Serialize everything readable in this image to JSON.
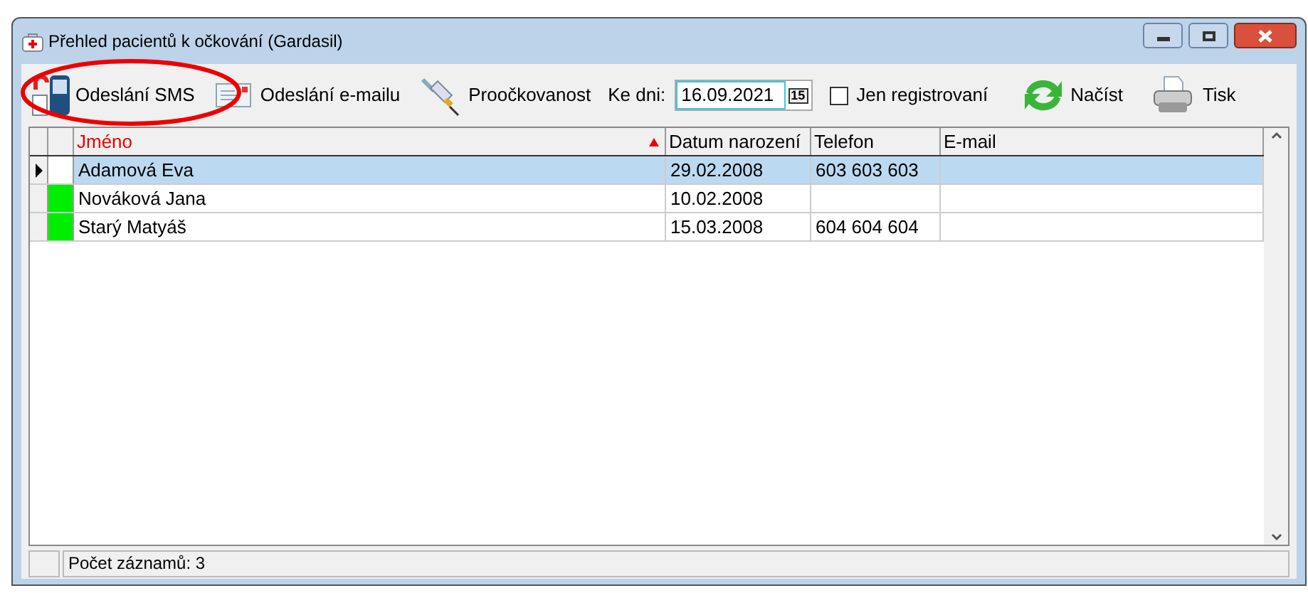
{
  "window": {
    "title": "Přehled pacientů k očkování (Gardasil)"
  },
  "toolbar": {
    "sms_button": {
      "label": "Odeslání SMS",
      "highlighted": true
    },
    "email_button": {
      "label": "Odeslání e-mailu"
    },
    "coverage_button": {
      "label": "Proočkovanost"
    },
    "date": {
      "label": "Ke dni:",
      "value": "16.09.2021",
      "calendar_glyph": "15"
    },
    "registered_only": {
      "label": "Jen registrovaní",
      "checked": false
    },
    "load_button": {
      "label": "Načíst"
    },
    "print_button": {
      "label": "Tisk"
    }
  },
  "table": {
    "columns": [
      {
        "label": "Jméno",
        "sorted": true
      },
      {
        "label": "Datum narození",
        "sorted": false
      },
      {
        "label": "Telefon",
        "sorted": false
      },
      {
        "label": "E-mail",
        "sorted": false
      }
    ],
    "rows": [
      {
        "selected": true,
        "color": "#ffffff",
        "cells": [
          "Adamová Eva",
          "29.02.2008",
          "603 603 603",
          ""
        ]
      },
      {
        "selected": false,
        "color": "#00ee00",
        "cells": [
          "Nováková Jana",
          "10.02.2008",
          "",
          ""
        ]
      },
      {
        "selected": false,
        "color": "#00ee00",
        "cells": [
          "Starý Matyáš",
          "15.03.2008",
          "604 604 604",
          ""
        ]
      }
    ]
  },
  "status_bar": {
    "text": "Počet záznamů: 3"
  }
}
